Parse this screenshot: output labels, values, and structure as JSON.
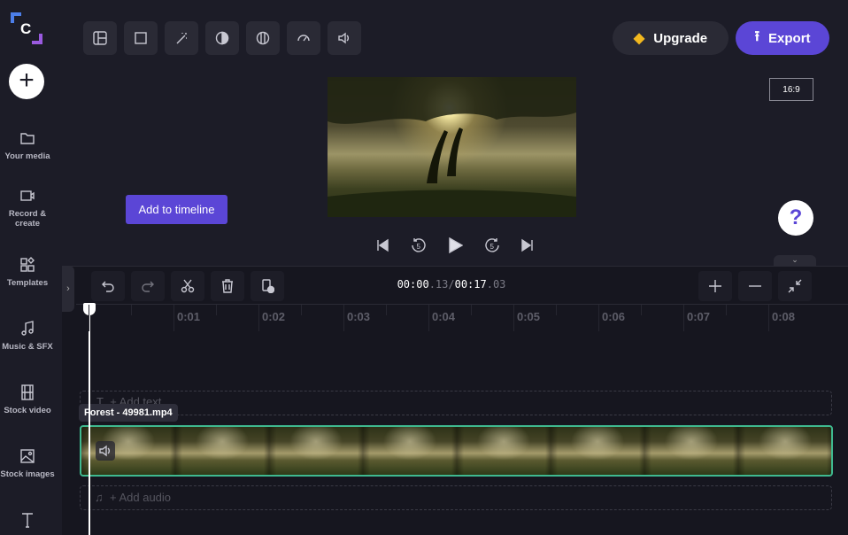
{
  "app": {
    "logo_letter": "C"
  },
  "sidebar": {
    "add_label": "+",
    "items": [
      {
        "label": "Your media",
        "icon": "folder-icon"
      },
      {
        "label": "Record & create",
        "icon": "camera-icon"
      },
      {
        "label": "Templates",
        "icon": "templates-icon"
      },
      {
        "label": "Music & SFX",
        "icon": "music-icon"
      },
      {
        "label": "Stock video",
        "icon": "film-icon"
      },
      {
        "label": "Stock images",
        "icon": "image-icon"
      },
      {
        "label": "",
        "icon": "text-icon"
      }
    ]
  },
  "toolbar": {
    "tools": [
      "layout-icon",
      "crop-icon",
      "magic-wand-icon",
      "contrast-icon",
      "filter-icon",
      "speed-icon",
      "volume-icon"
    ]
  },
  "header": {
    "upgrade_label": "Upgrade",
    "export_label": "Export",
    "accent": "#5b46d6",
    "gem_color": "#f2b81f"
  },
  "preview": {
    "aspect_ratio": "16:9"
  },
  "tooltip": {
    "label": "Add to timeline"
  },
  "help": {
    "label": "?"
  },
  "playback": {
    "controls": [
      "skip-back-icon",
      "rewind-5-icon",
      "play-icon",
      "forward-5-icon",
      "skip-forward-icon"
    ],
    "rew": "5",
    "fwd": "5"
  },
  "timeline": {
    "current_main": "00:00",
    "current_frac": ".13",
    "sep": "/",
    "total_main": "00:17",
    "total_frac": ".03",
    "ruler": [
      "0:01",
      "0:02",
      "0:03",
      "0:04",
      "0:05",
      "0:06",
      "0:07",
      "0:08"
    ],
    "text_track": "+ Add text",
    "audio_track": "+ Add audio",
    "clip_name": "Forest - 49981.mp4",
    "clip_color": "#3fb98f"
  }
}
